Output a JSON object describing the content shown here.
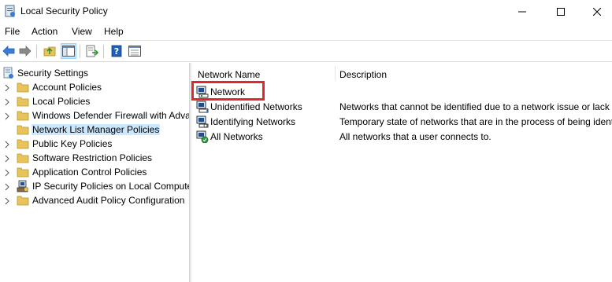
{
  "window": {
    "title": "Local Security Policy"
  },
  "menu": {
    "file": "File",
    "action": "Action",
    "view": "View",
    "help": "Help"
  },
  "toolbar": {
    "buttons": [
      "back-arrow-icon",
      "forward-arrow-icon",
      "up-folder-icon",
      "show-hide-tree-icon",
      "export-list-icon",
      "help-icon",
      "properties-icon"
    ]
  },
  "tree": {
    "root": "Security Settings",
    "items": [
      {
        "label": "Account Policies",
        "expandable": true
      },
      {
        "label": "Local Policies",
        "expandable": true
      },
      {
        "label": "Windows Defender Firewall with Adva",
        "expandable": true
      },
      {
        "label": "Network List Manager Policies",
        "expandable": false,
        "selected": true
      },
      {
        "label": "Public Key Policies",
        "expandable": true
      },
      {
        "label": "Software Restriction Policies",
        "expandable": true
      },
      {
        "label": "Application Control Policies",
        "expandable": true
      },
      {
        "label": "IP Security Policies on Local Compute",
        "expandable": true
      },
      {
        "label": "Advanced Audit Policy Configuration",
        "expandable": true
      }
    ]
  },
  "list": {
    "columns": {
      "name": "Network Name",
      "description": "Description"
    },
    "rows": [
      {
        "name": "Network",
        "description": "",
        "highlighted": true
      },
      {
        "name": "Unidentified Networks",
        "description": "Networks that cannot be identified due to a network issue or lack"
      },
      {
        "name": "Identifying Networks",
        "description": "Temporary state of networks that are in the process of being ident"
      },
      {
        "name": "All Networks",
        "description": "All networks that a user connects to."
      }
    ]
  },
  "colors": {
    "selection": "#cce8ff",
    "highlight_border": "#e0282e",
    "folder": "#e8c25a"
  }
}
